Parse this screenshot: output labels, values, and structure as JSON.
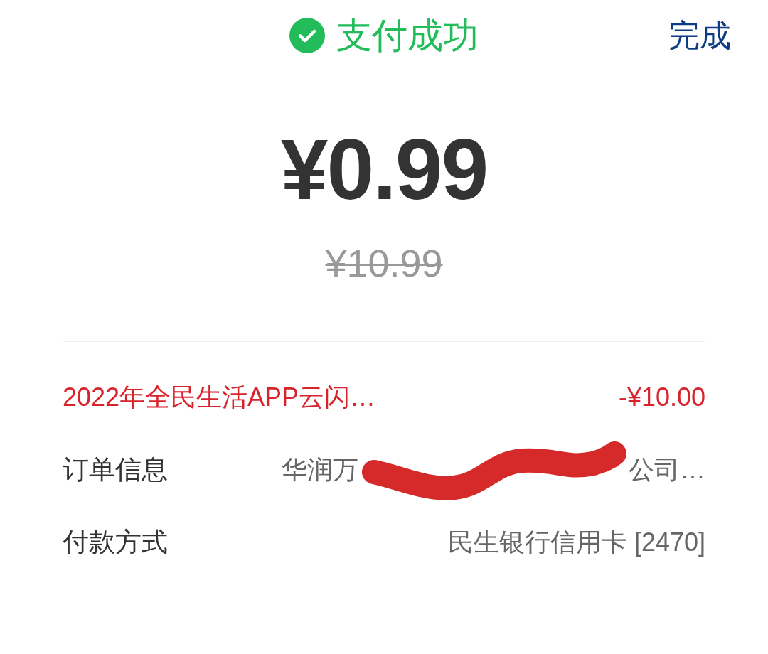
{
  "header": {
    "title": "支付成功",
    "done_button": "完成"
  },
  "amount": {
    "paid": "¥0.99",
    "original": "¥10.99"
  },
  "discount": {
    "name": "2022年全民生活APP云闪…",
    "amount": "-¥10.00"
  },
  "details": [
    {
      "label": "订单信息",
      "value_start": "华润万",
      "value_end": "公司…",
      "redacted": true
    },
    {
      "label": "付款方式",
      "value_start": "民生银行信用卡 [2470]",
      "redacted": false
    }
  ]
}
